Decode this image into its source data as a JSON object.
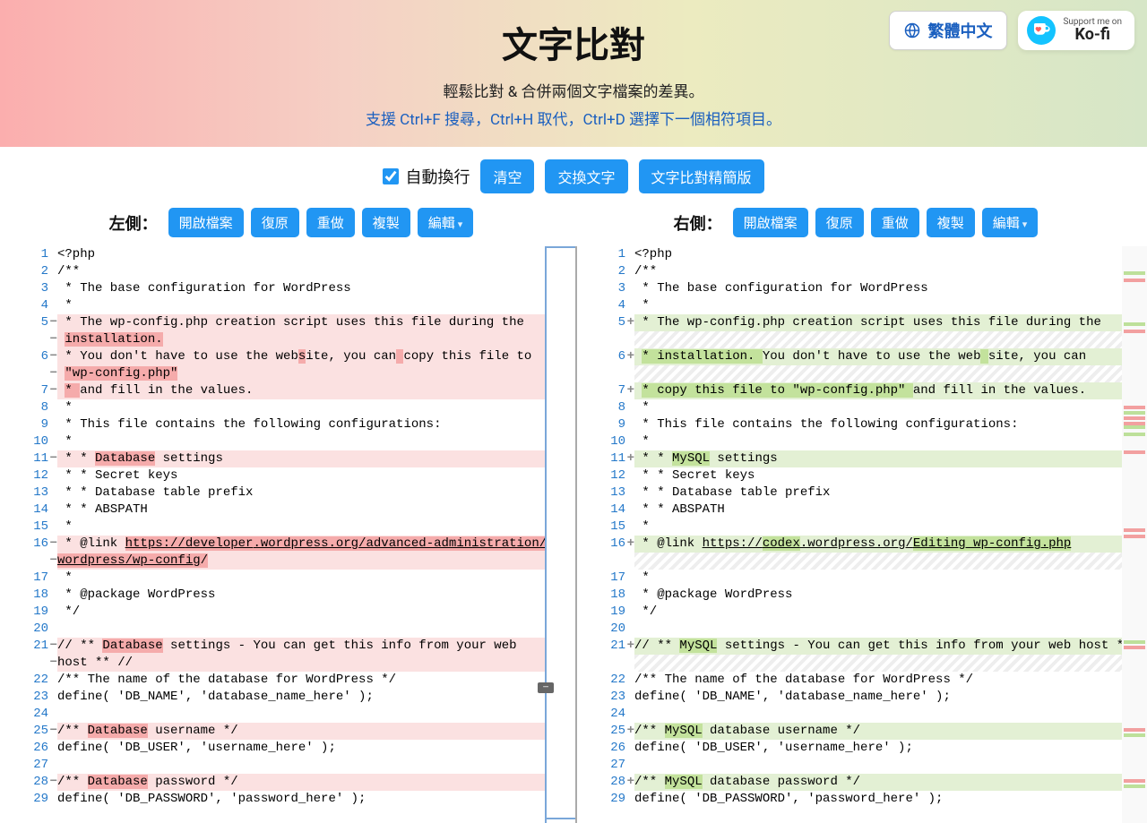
{
  "header": {
    "title": "文字比對",
    "subtitle": "輕鬆比對 & 合併兩個文字檔案的差異。",
    "hint": "支援 Ctrl+F 搜尋，Ctrl+H 取代，Ctrl+D 選擇下一個相符項目。",
    "lang": "繁體中文",
    "kofi_small": "Support me on",
    "kofi_big": "Ko-fi"
  },
  "toolbar": {
    "wrap": "自動換行",
    "clear": "清空",
    "swap": "交換文字",
    "lite": "文字比對精簡版"
  },
  "sides": {
    "left_label": "左側：",
    "right_label": "右側：",
    "open": "開啟檔案",
    "undo": "復原",
    "redo": "重做",
    "copy": "複製",
    "edit": "編輯"
  },
  "left": [
    {
      "n": "1",
      "t": "<?php"
    },
    {
      "n": "2",
      "t": "/**"
    },
    {
      "n": "3",
      "t": " * The base configuration for WordPress"
    },
    {
      "n": "4",
      "t": " *"
    },
    {
      "n": "5",
      "m": "del",
      "bg": "ldiff",
      "seg": [
        " * The wp-config.php creation script uses this file during the"
      ]
    },
    {
      "n": "",
      "m": "del",
      "bg": "ldiff",
      "seg": [
        " ",
        [
          "installation.",
          "hl-del"
        ]
      ]
    },
    {
      "n": "6",
      "m": "del",
      "bg": "ldiff",
      "seg": [
        " * You don't have to use the web",
        [
          "s",
          "hl-del"
        ],
        "ite, you can",
        [
          " ",
          "hl-del"
        ],
        "copy this file to "
      ]
    },
    {
      "n": "",
      "m": "del",
      "bg": "ldiff",
      "seg": [
        " ",
        [
          "\"wp-config.php\"",
          "hl-del"
        ]
      ]
    },
    {
      "n": "7",
      "m": "del",
      "bg": "ldiff",
      "seg": [
        " ",
        [
          "* ",
          "hl-del"
        ],
        "and fill in the values."
      ]
    },
    {
      "n": "8",
      "t": " *"
    },
    {
      "n": "9",
      "t": " * This file contains the following configurations:"
    },
    {
      "n": "10",
      "t": " *"
    },
    {
      "n": "11",
      "m": "del",
      "bg": "ldiff",
      "seg": [
        " * * ",
        [
          "Database",
          "hl-del"
        ],
        " settings"
      ]
    },
    {
      "n": "12",
      "t": " * * Secret keys"
    },
    {
      "n": "13",
      "t": " * * Database table prefix"
    },
    {
      "n": "14",
      "t": " * * ABSPATH"
    },
    {
      "n": "15",
      "t": " *"
    },
    {
      "n": "16",
      "m": "del",
      "bg": "ldiff",
      "seg": [
        " * @link ",
        [
          "https://",
          ""
        ],
        [
          "developer",
          ""
        ],
        [
          ".wordpress.org/",
          ""
        ],
        [
          "advanced-administration/",
          ""
        ]
      ],
      "u": 1,
      "hlrest": "hl-del"
    },
    {
      "n": "",
      "m": "del",
      "bg": "ldiff",
      "seg": [
        [
          "wordpress/wp-config",
          ""
        ],
        [
          "/",
          "hl-del"
        ]
      ],
      "u": 1,
      "hlrest": "hl-del"
    },
    {
      "n": "17",
      "t": " *"
    },
    {
      "n": "18",
      "t": " * @package WordPress"
    },
    {
      "n": "19",
      "t": " */"
    },
    {
      "n": "20",
      "t": ""
    },
    {
      "n": "21",
      "m": "del",
      "bg": "ldiff",
      "seg": [
        "// ** ",
        [
          "Database",
          "hl-del"
        ],
        " settings - You can get this info from your web "
      ]
    },
    {
      "n": "",
      "m": "del",
      "bg": "ldiff",
      "t": "host ** //"
    },
    {
      "n": "22",
      "t": "/** The name of the database for WordPress */"
    },
    {
      "n": "23",
      "t": "define( 'DB_NAME', 'database_name_here' );"
    },
    {
      "n": "24",
      "t": ""
    },
    {
      "n": "25",
      "m": "del",
      "bg": "ldiff",
      "seg": [
        "/** ",
        [
          "Database",
          "hl-del"
        ],
        " username */"
      ]
    },
    {
      "n": "26",
      "t": "define( 'DB_USER', 'username_here' );"
    },
    {
      "n": "27",
      "t": ""
    },
    {
      "n": "28",
      "m": "del",
      "bg": "ldiff",
      "seg": [
        "/** ",
        [
          "Database",
          "hl-del"
        ],
        " password */"
      ]
    },
    {
      "n": "29",
      "t": "define( 'DB_PASSWORD', 'password_here' );"
    }
  ],
  "right": [
    {
      "n": "1",
      "t": "<?php"
    },
    {
      "n": "2",
      "t": "/**"
    },
    {
      "n": "3",
      "t": " * The base configuration for WordPress"
    },
    {
      "n": "4",
      "t": " *"
    },
    {
      "n": "5",
      "m": "add",
      "bg": "rdiff",
      "seg": [
        " * The wp-config.php creation script uses this file during the"
      ]
    },
    {
      "n": "",
      "bg": "hatch",
      "t": ""
    },
    {
      "n": "6",
      "m": "add",
      "bg": "rdiff",
      "seg": [
        " ",
        [
          "* installation. ",
          "hl-add"
        ],
        "You don't have to use the web",
        [
          " ",
          "hl-add"
        ],
        "site, you can"
      ]
    },
    {
      "n": "",
      "bg": "hatch",
      "t": ""
    },
    {
      "n": "7",
      "m": "add",
      "bg": "rdiff",
      "seg": [
        " ",
        [
          "* copy this file to \"wp-config.php\" ",
          "hl-add"
        ],
        "and fill in the values."
      ]
    },
    {
      "n": "8",
      "t": " *"
    },
    {
      "n": "9",
      "t": " * This file contains the following configurations:"
    },
    {
      "n": "10",
      "t": " *"
    },
    {
      "n": "11",
      "m": "add",
      "bg": "rdiff",
      "seg": [
        " * * ",
        [
          "MySQL",
          "hl-add"
        ],
        " settings"
      ]
    },
    {
      "n": "12",
      "t": " * * Secret keys"
    },
    {
      "n": "13",
      "t": " * * Database table prefix"
    },
    {
      "n": "14",
      "t": " * * ABSPATH"
    },
    {
      "n": "15",
      "t": " *"
    },
    {
      "n": "16",
      "m": "add",
      "bg": "rdiff",
      "seg": [
        " * @link ",
        [
          "https://",
          "u"
        ],
        [
          "codex",
          "u hl-add"
        ],
        [
          ".wordpress.org/",
          "u"
        ],
        [
          "Editing_wp-config.php",
          "u hl-add"
        ]
      ]
    },
    {
      "n": "",
      "bg": "hatch",
      "t": ""
    },
    {
      "n": "17",
      "t": " *"
    },
    {
      "n": "18",
      "t": " * @package WordPress"
    },
    {
      "n": "19",
      "t": " */"
    },
    {
      "n": "20",
      "t": ""
    },
    {
      "n": "21",
      "m": "add",
      "bg": "rdiff",
      "seg": [
        "// ** ",
        [
          "MySQL",
          "hl-add"
        ],
        " settings - You can get this info from your web host ** //"
      ]
    },
    {
      "n": "",
      "bg": "hatch",
      "t": ""
    },
    {
      "n": "22",
      "t": "/** The name of the database for WordPress */"
    },
    {
      "n": "23",
      "t": "define( 'DB_NAME', 'database_name_here' );"
    },
    {
      "n": "24",
      "t": ""
    },
    {
      "n": "25",
      "m": "add",
      "bg": "rdiff",
      "seg": [
        "/** ",
        [
          "MySQL",
          "hl-add"
        ],
        " database username */"
      ]
    },
    {
      "n": "26",
      "t": "define( 'DB_USER', 'username_here' );"
    },
    {
      "n": "27",
      "t": ""
    },
    {
      "n": "28",
      "m": "add",
      "bg": "rdiff",
      "seg": [
        "/** ",
        [
          "MySQL",
          "hl-add"
        ],
        " database password */"
      ]
    },
    {
      "n": "29",
      "t": "define( 'DB_PASSWORD', 'password_here' );"
    }
  ],
  "minimap": [
    {
      "t": 28,
      "c": "add"
    },
    {
      "t": 36,
      "c": "del"
    },
    {
      "t": 85,
      "c": "add"
    },
    {
      "t": 93,
      "c": "del"
    },
    {
      "t": 178,
      "c": "del"
    },
    {
      "t": 184,
      "c": "add"
    },
    {
      "t": 190,
      "c": "del"
    },
    {
      "t": 196,
      "c": "del"
    },
    {
      "t": 200,
      "c": "add"
    },
    {
      "t": 208,
      "c": "add"
    },
    {
      "t": 228,
      "c": "del"
    },
    {
      "t": 315,
      "c": "del"
    },
    {
      "t": 322,
      "c": "del"
    },
    {
      "t": 440,
      "c": "add"
    },
    {
      "t": 446,
      "c": "del"
    },
    {
      "t": 538,
      "c": "del"
    },
    {
      "t": 544,
      "c": "add"
    },
    {
      "t": 595,
      "c": "del"
    },
    {
      "t": 601,
      "c": "add"
    }
  ]
}
